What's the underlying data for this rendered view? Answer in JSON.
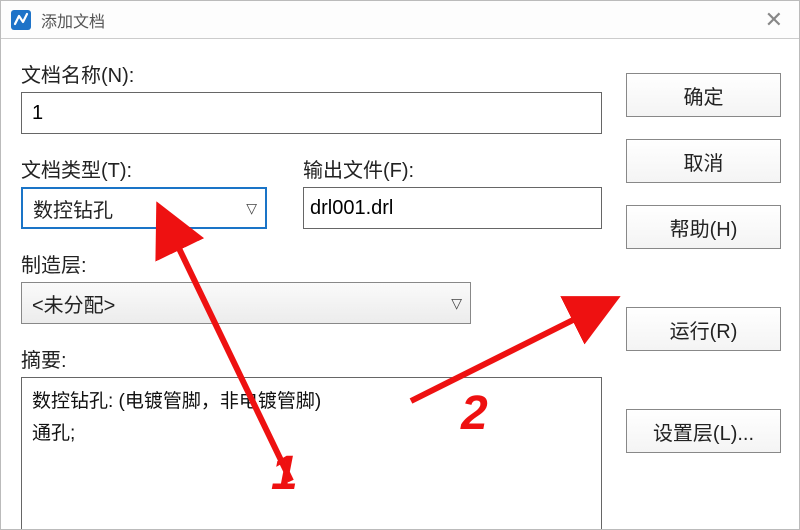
{
  "window": {
    "title": "添加文档"
  },
  "labels": {
    "docName": "文档名称(N):",
    "docType": "文档类型(T):",
    "outputFile": "输出文件(F):",
    "mfgLayer": "制造层:",
    "summary": "摘要:"
  },
  "fields": {
    "docName": "1",
    "docType": "数控钻孔",
    "outputFile": "drl001.drl",
    "mfgLayer": "<未分配>",
    "summaryText": "数控钻孔: (电镀管脚，非电镀管脚)\n通孔;"
  },
  "buttons": {
    "ok": "确定",
    "cancel": "取消",
    "help": "帮助(H)",
    "run": "运行(R)",
    "setLayer": "设置层(L)..."
  },
  "annotations": {
    "one": "1",
    "two": "2"
  }
}
